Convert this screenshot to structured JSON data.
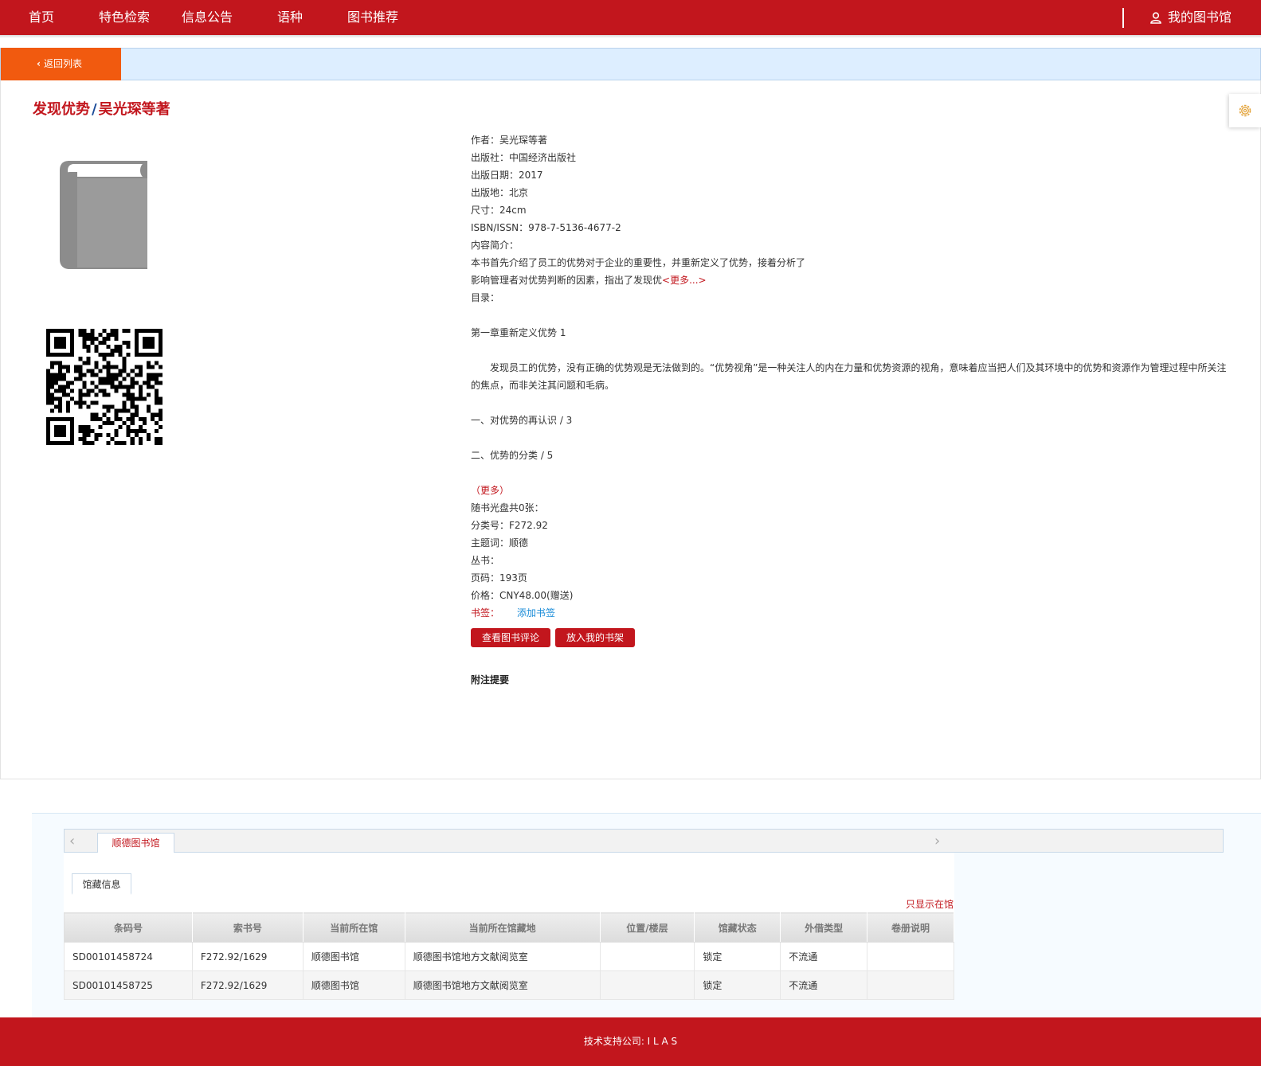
{
  "nav": {
    "items": [
      "首页",
      "特色检索",
      "信息公告",
      "语种",
      "图书推荐"
    ],
    "my_library": "我的图书馆"
  },
  "subbar": {
    "back_label": "返回列表"
  },
  "book": {
    "title": "发现优势",
    "separator": "/",
    "author_line": "吴光琛等著"
  },
  "meta": {
    "author": "作者：吴光琛等著",
    "publisher": "出版社：中国经济出版社",
    "pub_date": "出版日期：2017",
    "pub_place": "出版地：北京",
    "size": "尺寸：24cm",
    "isbn": "ISBN/ISSN：978-7-5136-4677-2",
    "summary_label": "内容简介：",
    "summary_1": "本书首先介绍了员工的优势对于企业的重要性，并重新定义了优势，接着分析了",
    "summary_2": "影响管理者对优势判断的因素，指出了发现优",
    "summary_more": "<更多...>",
    "toc_label": "目录：",
    "toc_ch1": "第一章重新定义优势 1",
    "toc_para": "发现员工的优势，没有正确的优势观是无法做到的。“优势视角”是一种关注人的内在力量和优势资源的视角，意味着应当把人们及其环境中的优势和资源作为管理过程中所关注的焦点，而非关注其问题和毛病。",
    "toc_1": "一、对优势的再认识 / 3",
    "toc_2": "二、优势的分类 / 5",
    "toc_more_open": "（",
    "toc_more": "更多",
    "toc_more_close": "）",
    "disc": "随书光盘共0张：",
    "class_no": "分类号：F272.92",
    "subject": "主题词：顺德",
    "series": "丛书：",
    "pages": "页码：193页",
    "price": "价格：CNY48.00(赠送)",
    "bookmark_label": "书签：",
    "bookmark_add": "添加书签",
    "btn_reviews": "查看图书评论",
    "btn_shelf": "放入我的书架",
    "note_title": "附注提要"
  },
  "library_tabs": {
    "active": "顺德图书馆"
  },
  "holdings": {
    "tab": "馆藏信息",
    "only_here": "只显示在馆",
    "headers": [
      "条码号",
      "索书号",
      "当前所在馆",
      "当前所在馆藏地",
      "位置/楼层",
      "馆藏状态",
      "外借类型",
      "卷册说明"
    ],
    "rows": [
      [
        "SD00101458724",
        "F272.92/1629",
        "顺德图书馆",
        "顺德图书馆地方文献阅览室",
        "",
        "锁定",
        "不流通",
        ""
      ],
      [
        "SD00101458725",
        "F272.92/1629",
        "顺德图书馆",
        "顺德图书馆地方文献阅览室",
        "",
        "锁定",
        "不流通",
        ""
      ]
    ]
  },
  "footer": {
    "text": "技术支持公司: I L A S"
  },
  "colors": {
    "brand_red": "#c2161d",
    "back_orange": "#f15a0f",
    "subbar_blue": "#ddeeff",
    "link_blue": "#1a8cd8"
  }
}
